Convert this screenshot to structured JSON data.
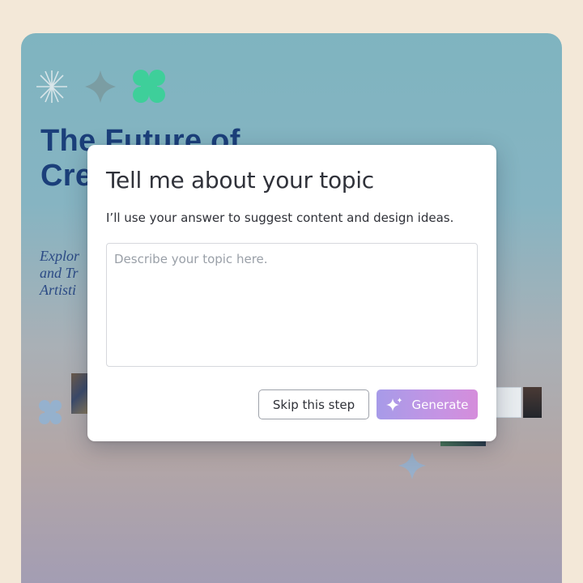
{
  "slide": {
    "title_line1": "The Future of",
    "title_line2": "Cre",
    "subtitle_line1": "Explor",
    "subtitle_line2": "and Tr",
    "subtitle_line3": "Artisti"
  },
  "dialog": {
    "title": "Tell me about your topic",
    "description": "I’ll use your answer to suggest content and design ideas.",
    "input_placeholder": "Describe your topic here.",
    "input_value": "",
    "skip_label": "Skip this step",
    "generate_label": "Generate",
    "generate_icon": "sparkle-icon"
  },
  "colors": {
    "page_background": "#f3e8d8",
    "title_color": "#1b3f7a",
    "generate_gradient_start": "#a79be8",
    "generate_gradient_end": "#d58ddb"
  }
}
